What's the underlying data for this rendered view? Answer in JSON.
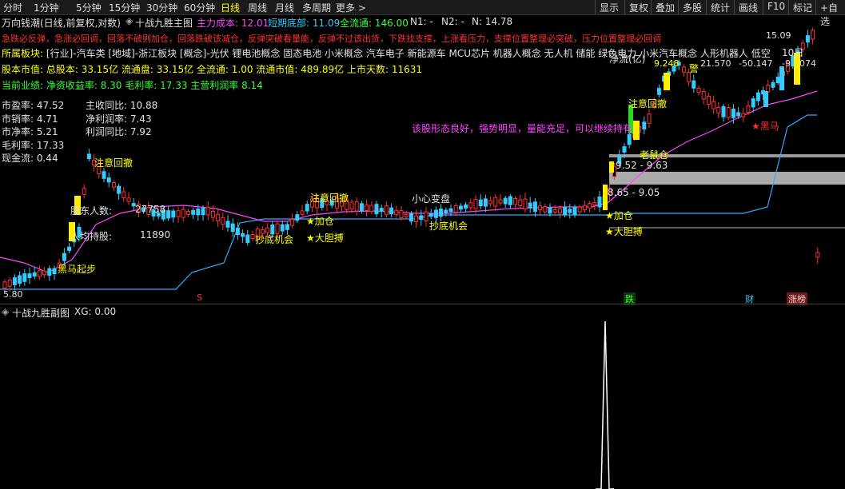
{
  "toolbar": {
    "periods": [
      "分时",
      "1分钟",
      "5分钟",
      "15分钟",
      "30分钟",
      "60分钟",
      "日线",
      "周线",
      "月线",
      "多周期",
      "更多 >"
    ],
    "active_period": "日线",
    "right": [
      "显示",
      "复权",
      "叠加",
      "多股",
      "统计",
      "画线",
      "F10",
      "标记",
      "+自选"
    ]
  },
  "header": {
    "stock_name": "万向钱潮(日线,前复权,对数)",
    "indicator_name": "十战九胜主图",
    "main_cost_label": "主力成本: 12.01",
    "short_bottom_label": "短期底部: 11.09",
    "float_label": "全流通: 146.00",
    "n1_label": "N1: -",
    "n2_label": "N2: -",
    "n_label": "N: 14.78"
  },
  "signals_line": "急跌必反弹，急涨必回调，回落不破则加仓，回落跌破该减仓，反弹突破看量能，反弹不过该出货，下跌找支撑，上涨看压力，支撑位置整理必突破，压力位置整理必回调",
  "sector": {
    "label": "所属板块:",
    "value": "[行业]-汽车类 [地域]-浙江板块 [概念]-光伏 锂电池概念 固态电池 小米概念 汽车电子 新能源车 MCU芯片 机器人概念 无人机 储能 绿色电力 小米汽车概念 人形机器人 低空经济"
  },
  "market_value": "股本市值: 总股本: 33.15亿 流通盘: 33.15亿 全流通: 1.00 流通市值: 489.89亿 上市天数: 11631",
  "performance": "当前业绩: 净资收益率: 8.30 毛利率: 17.33 主营利润率 8.14",
  "fundamentals": {
    "left": [
      "市盈率: 47.52",
      "市销率: 4.71",
      "市净率: 5.21",
      "毛利率: 17.33",
      "现金流: 0.44"
    ],
    "right": [
      "主收同比: 10.88",
      "净利润率: 7.43",
      "利润同比: 7.92"
    ]
  },
  "holders": {
    "count_label": "股东人数:",
    "count_value": "27758",
    "avg_label": "人均持股:",
    "avg_value": "11890"
  },
  "annotations": {
    "comment": "该股形态良好，强势明显，量能充足，可以继续持有",
    "black_horse_start": "黑马起步",
    "attention_pullback_1": "注意回撤",
    "attention_pullback_2": "注意回撤",
    "attention_pullback_3": "注意回撤",
    "careful_change": "小心变盘",
    "bottom_chance_1": "抄底机会",
    "bottom_chance_2": "抄底机会",
    "add_pos_1": "★加仓",
    "add_pos_2": "★加仓",
    "bold_1": "★大胆搏",
    "bold_2": "★大胆搏",
    "black_horse": "★黑马",
    "old_rat": "老鼠仓",
    "zone_upper": "9.52 - 9.63",
    "zone_lower": "8.65 - 9.05",
    "price_15": "15.09",
    "price_9248": "9.248",
    "price_21570": "21.570",
    "price_50147": "-50.147",
    "price_neg9": "-9",
    "price_074": "074",
    "ten_day": "10日",
    "warn": "警",
    "low_price": "5.80",
    "dbl_label": "净流(亿)"
  },
  "bottom_markers": {
    "s": "S",
    "die": "跌",
    "cai": "财",
    "zhang": "涨榜"
  },
  "sub": {
    "title": "十战九胜副图",
    "xg": "XG: 0.00"
  },
  "colors": {
    "up": "#ff3030",
    "down": "#33ccff",
    "ma": "#ff44ff",
    "support": "#33aaff",
    "signal": "#ffff00",
    "bg": "#000000"
  }
}
